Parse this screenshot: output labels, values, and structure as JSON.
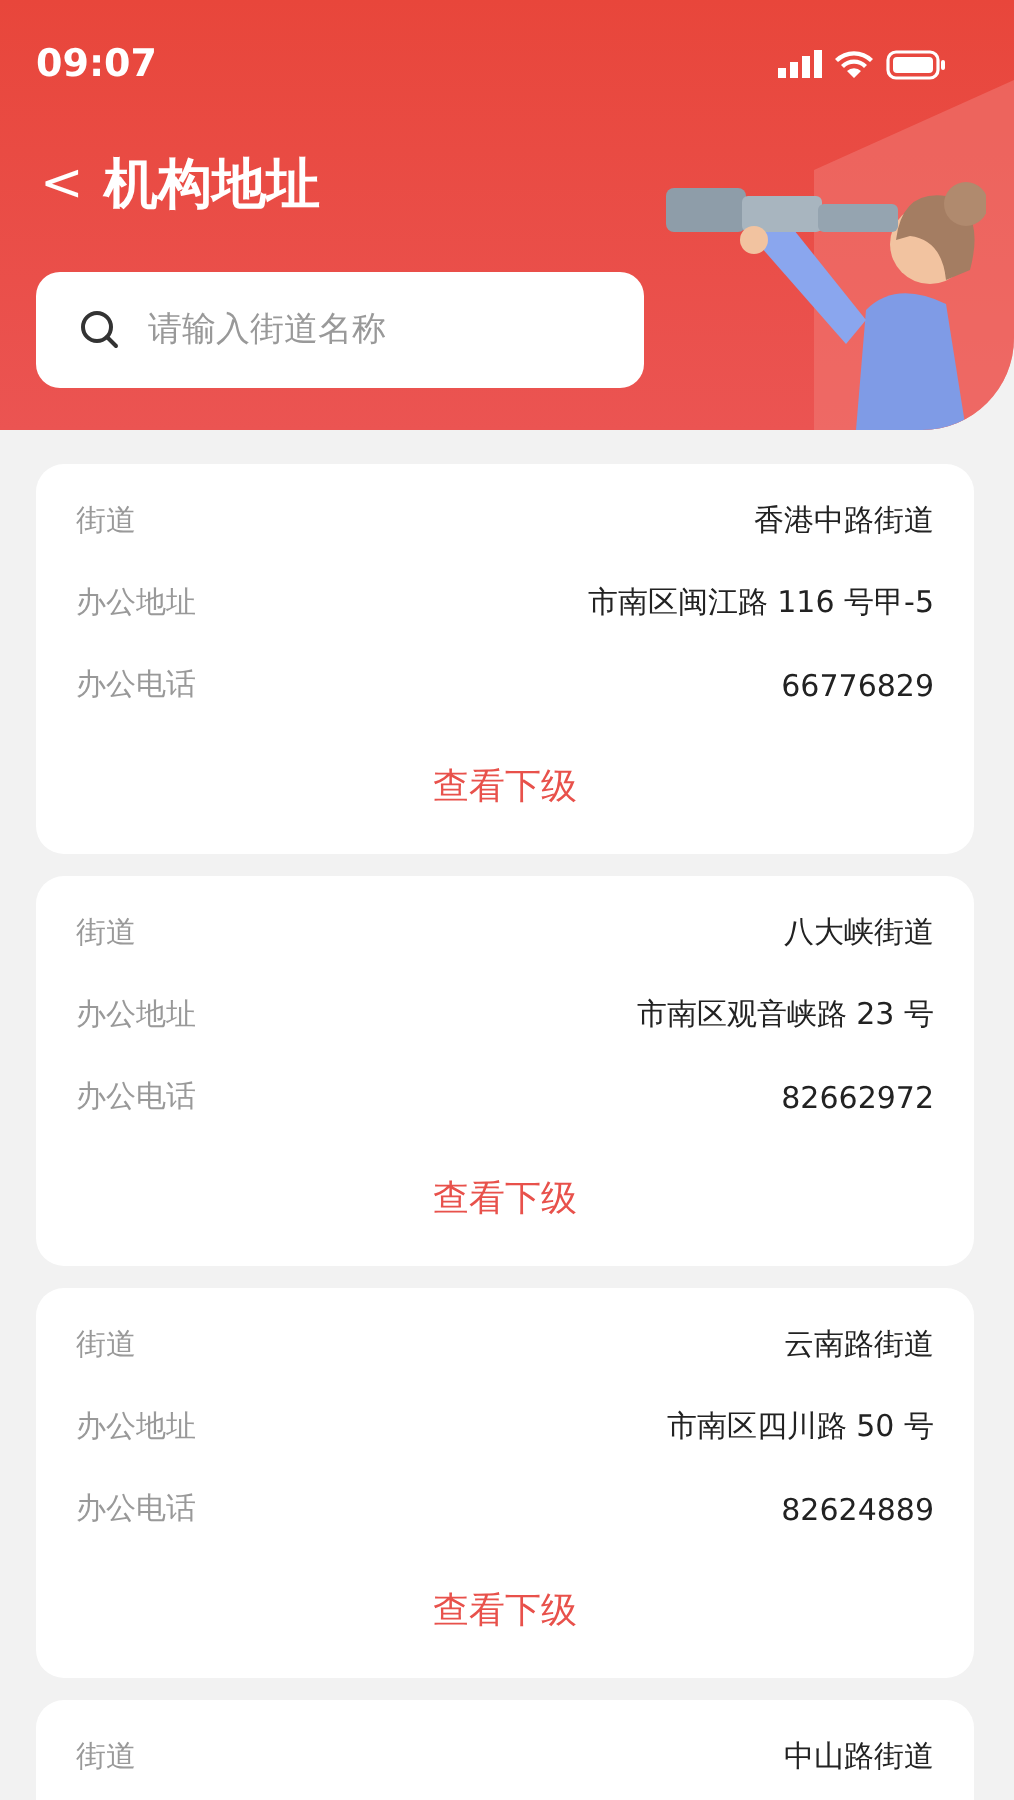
{
  "status_bar": {
    "time": "09:07"
  },
  "header": {
    "back_icon": "<",
    "title": "机构地址"
  },
  "search": {
    "placeholder": "请输入街道名称"
  },
  "cards": [
    {
      "rows": [
        {
          "label": "街道",
          "value": "香港中路街道"
        },
        {
          "label": "办公地址",
          "value": "市南区闽江路 116 号甲-5"
        },
        {
          "label": "办公电话",
          "value": "66776829"
        }
      ],
      "link": "查看下级"
    },
    {
      "rows": [
        {
          "label": "街道",
          "value": "八大峡街道"
        },
        {
          "label": "办公地址",
          "value": "市南区观音峡路 23 号"
        },
        {
          "label": "办公电话",
          "value": "82662972"
        }
      ],
      "link": "查看下级"
    },
    {
      "rows": [
        {
          "label": "街道",
          "value": "云南路街道"
        },
        {
          "label": "办公地址",
          "value": "市南区四川路 50 号"
        },
        {
          "label": "办公电话",
          "value": "82624889"
        }
      ],
      "link": "查看下级"
    },
    {
      "rows": [
        {
          "label": "街道",
          "value": "中山路街道"
        }
      ]
    }
  ]
}
